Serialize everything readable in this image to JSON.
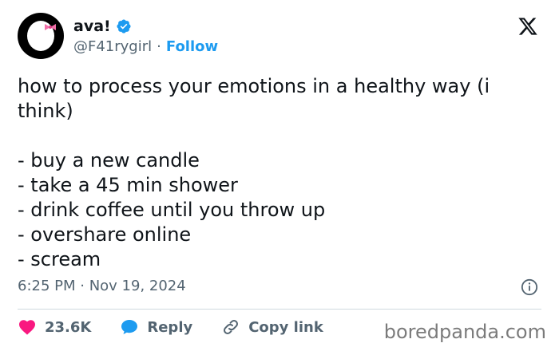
{
  "author": {
    "display_name": "ava!",
    "handle": "@F41rygirl",
    "separator": "·",
    "follow_label": "Follow"
  },
  "tweet": {
    "intro": "how to process your emotions in a healthy way (i think)",
    "items": [
      "- buy a new candle",
      "- take a 45 min shower",
      "- drink coffee until you throw up",
      "- overshare online",
      "- scream"
    ],
    "timestamp": "6:25 PM · Nov 19, 2024"
  },
  "actions": {
    "likes": "23.6K",
    "reply_label": "Reply",
    "copy_link_label": "Copy link"
  },
  "watermark": "boredpanda.com",
  "icons": {
    "verified": "verified-badge-icon",
    "platform": "x-logo-icon",
    "info": "info-icon",
    "like": "heart-icon",
    "reply": "speech-bubble-icon",
    "copy": "link-icon"
  },
  "colors": {
    "accent": "#1d9bf0",
    "like": "#f91880",
    "text": "#0f1419",
    "muted": "#536471"
  }
}
